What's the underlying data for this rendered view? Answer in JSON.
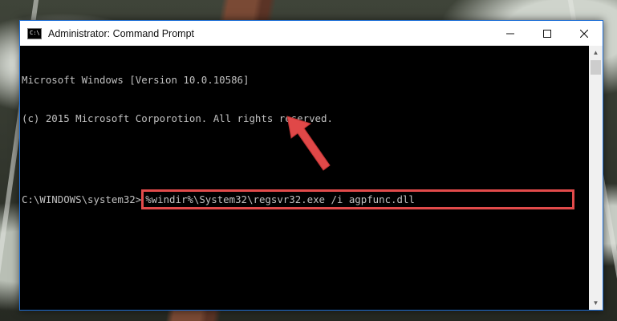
{
  "window": {
    "title": "Administrator: Command Prompt",
    "icon": "cmd-icon",
    "icon_text": "C:\\",
    "controls": [
      "minimize-icon",
      "maximize-icon",
      "close-icon"
    ]
  },
  "console": {
    "lines": [
      "Microsoft Windows [Version 10.0.10586]",
      "(c) 2015 Microsoft Corporotion. All rights reserved."
    ],
    "prompt": "C:\\WINDOWS\\system32>",
    "command": "%windir%\\System32\\regsvr32.exe /i agpfunc.dll"
  },
  "colors": {
    "highlight": "#e24b4b",
    "console_bg": "#000000",
    "console_text": "#c0c0c0",
    "window_border": "#1f6fd6"
  }
}
